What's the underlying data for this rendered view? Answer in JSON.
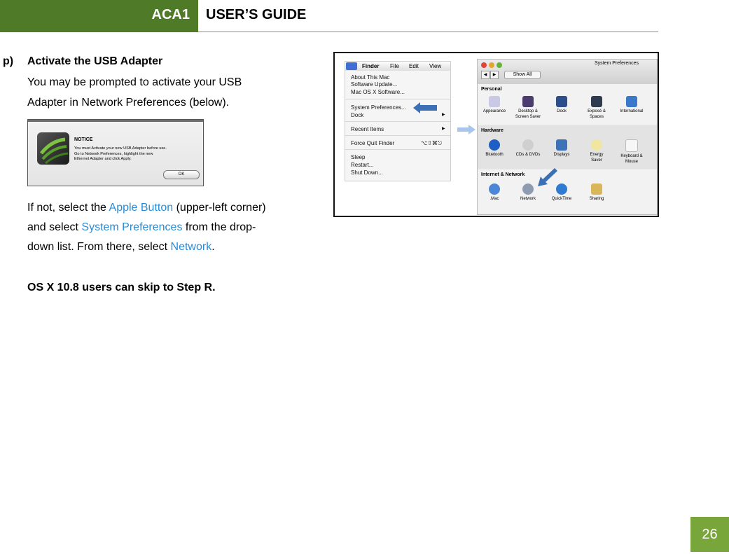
{
  "header": {
    "tab_label": "ACA1",
    "title": "USER’S GUIDE",
    "page_number": "26"
  },
  "step": {
    "letter": "p)",
    "heading": "Activate the USB Adapter",
    "intro_line1": "You may be prompted to activate your USB",
    "intro_line2": "Adapter in Network Preferences (below).",
    "instr_1a": "If not, select the ",
    "instr_1b": "Apple Button",
    "instr_1c": " (upper-left corner)",
    "instr_2a": "and select ",
    "instr_2b": "System Preferences",
    "instr_2c": " from the drop-",
    "instr_3a": "down list.  From there, select ",
    "instr_3b": "Network",
    "instr_3c": ".",
    "note": "OS X 10.8 users can skip to Step R."
  },
  "notice_dialog": {
    "title": "NOTICE",
    "line1": "You must Activate your new USB Adapter before use.",
    "line2": "Go to Network Preferences, highlight the new",
    "line3": "Ethernet Adapter and click Apply.",
    "ok_label": "OK"
  },
  "apple_menu": {
    "menubar": [
      "Finder",
      "File",
      "Edit",
      "View"
    ],
    "items": [
      "About This Mac",
      "Software Update...",
      "Mac OS X Software...",
      "System Preferences...",
      "Dock",
      "Recent Items",
      "Force Quit Finder",
      "Sleep",
      "Restart...",
      "Shut Down..."
    ],
    "force_quit_shortcut": "⌥⇧⌘⎋"
  },
  "system_preferences": {
    "window_title": "System Preferences",
    "show_all": "Show All",
    "sections": {
      "personal": {
        "label": "Personal",
        "items": [
          "Appearance",
          "Desktop &\nScreen Saver",
          "Dock",
          "Exposé &\nSpaces",
          "International"
        ]
      },
      "hardware": {
        "label": "Hardware",
        "items": [
          "Bluetooth",
          "CDs & DVDs",
          "Displays",
          "Energy\nSaver",
          "Keyboard &\nMouse"
        ]
      },
      "internet": {
        "label": "Internet & Network",
        "items": [
          ".Mac",
          "Network",
          "QuickTime",
          "Sharing"
        ]
      }
    }
  },
  "colors": {
    "header_green": "#4f7b28",
    "page_green": "#78a63a",
    "link_blue": "#2a8bd5",
    "arrow_blue": "#3b6fb6"
  }
}
